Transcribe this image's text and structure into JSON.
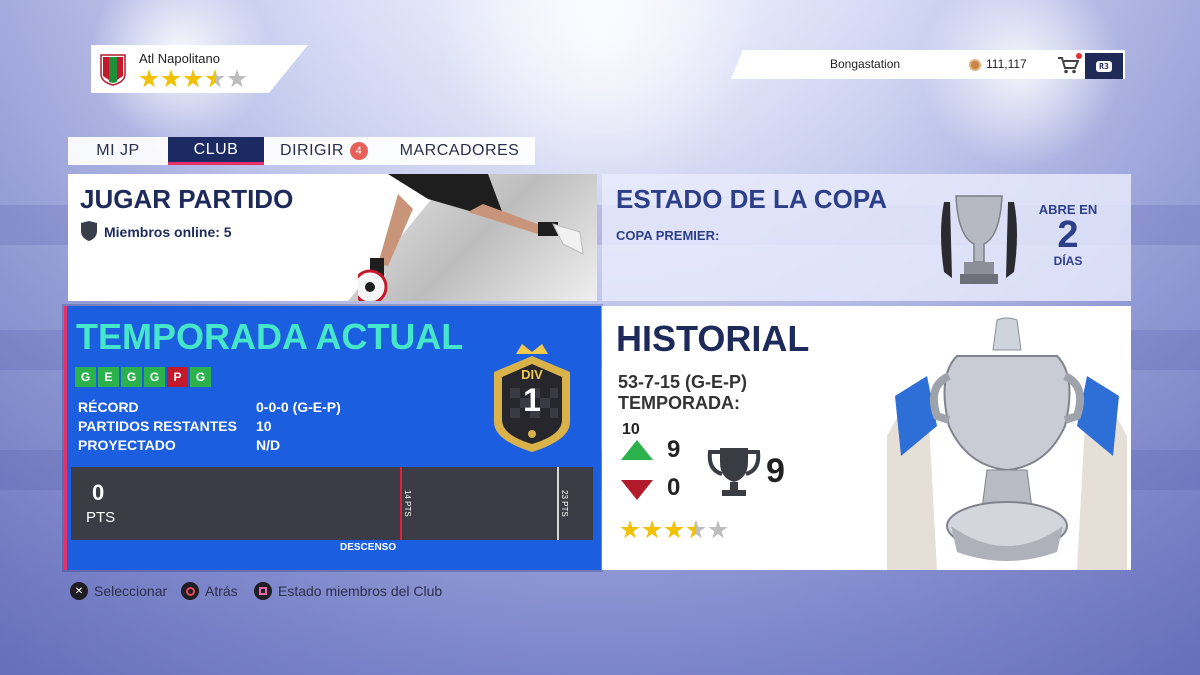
{
  "club": {
    "name": "Atl Napolitano",
    "stars": [
      1,
      1,
      1,
      0.5,
      0
    ]
  },
  "user": {
    "gamertag": "Bongastation",
    "coins": "111,117",
    "r3_label": "R3"
  },
  "tabs": [
    {
      "label": "MI JP",
      "active": false
    },
    {
      "label": "CLUB",
      "active": true
    },
    {
      "label": "DIRIGIR",
      "badge": "4",
      "active": false
    },
    {
      "label": "MARCADORES",
      "active": false
    }
  ],
  "jugar": {
    "title": "JUGAR PARTIDO",
    "online_label": "Miembros online: 5"
  },
  "copa": {
    "title": "ESTADO DE LA COPA",
    "subtitle": "COPA PREMIER:",
    "opens_label": "ABRE EN",
    "opens_value": "2",
    "opens_unit": "DÍAS"
  },
  "temporada": {
    "title": "TEMPORADA ACTUAL",
    "form": [
      "G",
      "E",
      "G",
      "G",
      "P",
      "G"
    ],
    "labels": [
      "RÉCORD",
      "PARTIDOS RESTANTES",
      "PROYECTADO"
    ],
    "values": [
      "0-0-0 (G-E-P)",
      "10",
      "N/D"
    ],
    "division_label": "DIV",
    "division_value": "1",
    "points": "0",
    "points_unit": "PTS",
    "marker_relegation": "14 PTS",
    "marker_title": "23 PTS",
    "relegation_label": "DESCENSO"
  },
  "historial": {
    "title": "HISTORIAL",
    "record": "53-7-15 (G-E-P)",
    "season_label": "TEMPORADA:",
    "season_value": "10",
    "promotions": "9",
    "relegations": "0",
    "titles": "9",
    "stars": [
      1,
      1,
      1,
      0.5,
      0
    ]
  },
  "footer": [
    {
      "icon": "cross-button-icon",
      "label": "Seleccionar"
    },
    {
      "icon": "circle-button-icon",
      "label": "Atrás"
    },
    {
      "icon": "square-button-icon",
      "label": "Estado miembros del Club"
    }
  ],
  "colors": {
    "accent": "#e6306a",
    "panel_blue": "#1b5fe0",
    "navy": "#1b2a63"
  }
}
